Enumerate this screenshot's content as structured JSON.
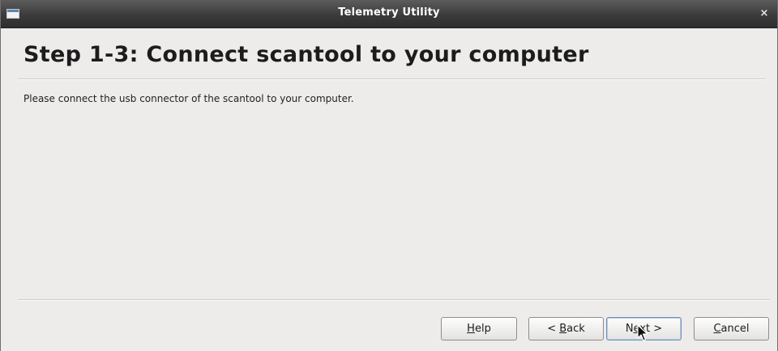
{
  "window": {
    "title": "Telemetry Utility",
    "close_symbol": "×"
  },
  "wizard": {
    "heading": "Step 1-3: Connect scantool to your computer",
    "instructions": "Please connect the usb connector of the scantool to your computer."
  },
  "buttons": {
    "help": {
      "text": "Help",
      "mnemonic": "H",
      "rest": "elp"
    },
    "back": {
      "prefix": "< ",
      "mnemonic": "B",
      "rest": "ack",
      "text": "< Back"
    },
    "next": {
      "prefix": "N",
      "mnemonic": "e",
      "rest": "xt >",
      "text": "Next >"
    },
    "cancel": {
      "text": "Cancel",
      "mnemonic": "C",
      "rest": "ancel"
    }
  },
  "icons": {
    "app": "window-icon",
    "close": "close-icon",
    "cursor": "mouse-pointer-icon"
  },
  "colors": {
    "titlebar": "#3b3b3b",
    "window_bg": "#edeceb",
    "focus_border": "#6f8fb7"
  }
}
